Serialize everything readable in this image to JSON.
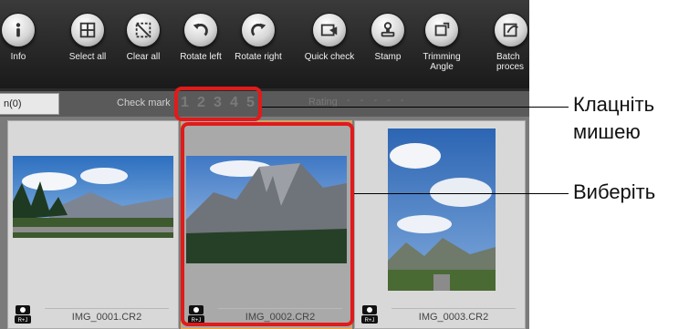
{
  "toolbar": {
    "buttons": [
      {
        "label": "Info",
        "icon": "info-icon"
      },
      {
        "label": "Select all",
        "icon": "select-all-icon"
      },
      {
        "label": "Clear all",
        "icon": "clear-all-icon"
      },
      {
        "label": "Rotate left",
        "icon": "rotate-left-icon"
      },
      {
        "label": "Rotate right",
        "icon": "rotate-right-icon"
      },
      {
        "label": "Quick check",
        "icon": "quick-check-icon"
      },
      {
        "label": "Stamp",
        "icon": "stamp-icon"
      },
      {
        "label": "Trimming Angle",
        "icon": "trimming-angle-icon"
      },
      {
        "label": "Batch proces",
        "icon": "batch-process-icon"
      }
    ]
  },
  "infobar": {
    "tab_label": "n(0)",
    "check_mark_label": "Check mark",
    "check_marks": [
      "1",
      "2",
      "3",
      "4",
      "5"
    ],
    "rating_label": "Rating",
    "rating_dots": "- - - - -"
  },
  "thumbnails": [
    {
      "filename": "IMG_0001.CR2",
      "badge": "R+J",
      "selected": false
    },
    {
      "filename": "IMG_0002.CR2",
      "badge": "R+J",
      "selected": true
    },
    {
      "filename": "IMG_0003.CR2",
      "badge": "R+J",
      "selected": false
    }
  ],
  "callouts": {
    "click_text": "Клацніть мишею",
    "click_line1": "Клацніть",
    "click_line2": "мишею",
    "select_text": "Виберіть"
  },
  "colors": {
    "highlight": "#e11a1a",
    "toolbar_bg": "#1a1a1a",
    "thumb_bg": "#d8d8d8",
    "selected_border": "#f0a030"
  }
}
